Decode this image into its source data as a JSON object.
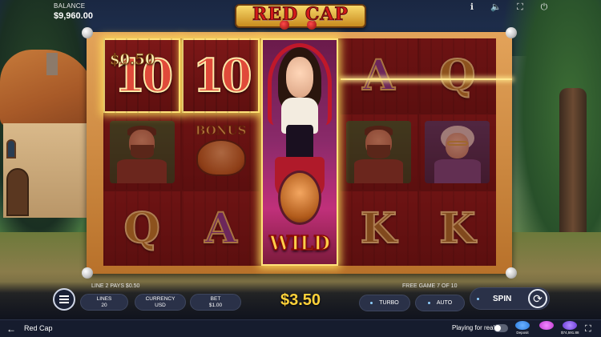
{
  "hud": {
    "balance_label": "BALANCE",
    "balance_value": "$9,960.00",
    "icons": [
      "info-icon",
      "mute-icon",
      "fullscreen-icon",
      "power-icon"
    ]
  },
  "logo": {
    "text": "RED CAP"
  },
  "reels": [
    [
      {
        "symbol": "10",
        "win": true,
        "win_amount": "$0.50"
      },
      {
        "symbol": "woodsman"
      },
      {
        "symbol": "Q"
      }
    ],
    [
      {
        "symbol": "10",
        "win": true
      },
      {
        "symbol": "BONUS",
        "label": "BONUS"
      },
      {
        "symbol": "A"
      }
    ],
    [
      {
        "symbol": "WILD",
        "win": true,
        "label": "WILD",
        "expanded": true
      }
    ],
    [
      {
        "symbol": "A"
      },
      {
        "symbol": "woodsman"
      },
      {
        "symbol": "K"
      }
    ],
    [
      {
        "symbol": "Q"
      },
      {
        "symbol": "grandma"
      },
      {
        "symbol": "K"
      }
    ]
  ],
  "symbols_text": {
    "r1c1": "10",
    "r1c3": "Q",
    "r2c1": "10",
    "r2c3": "A",
    "r4c1": "A",
    "r4c3": "K",
    "r5c1": "Q",
    "r5c3": "K"
  },
  "win_amount": "$0.50",
  "bonus_label": "BONUS",
  "wild_label": "WILD",
  "controls": {
    "line_pays": "LINE 2 PAYS $0.50",
    "free_game": "FREE GAME 7 OF 10",
    "lines_label": "LINES",
    "lines_value": "20",
    "currency_label": "CURRENCY",
    "currency_value": "USD",
    "bet_label": "BET",
    "bet_value": "$1.00",
    "total_bet": "$3.50",
    "turbo_label": "TURBO",
    "auto_label": "AUTO",
    "spin_label": "SPIN"
  },
  "bottom_bar": {
    "game_name": "Red Cap",
    "play_real_label": "Playing for real",
    "promos": [
      {
        "caption": "Deposit",
        "color": "#2d7de0"
      },
      {
        "caption": "",
        "color": "#c23ad2"
      },
      {
        "caption": "$74,591.88",
        "color": "#6a3ad8"
      }
    ]
  },
  "colors": {
    "accent_gold": "#ffd23a",
    "win_glow": "#ffe27a",
    "reel_bg": "#7e1818",
    "frame": "#e3a35a"
  }
}
